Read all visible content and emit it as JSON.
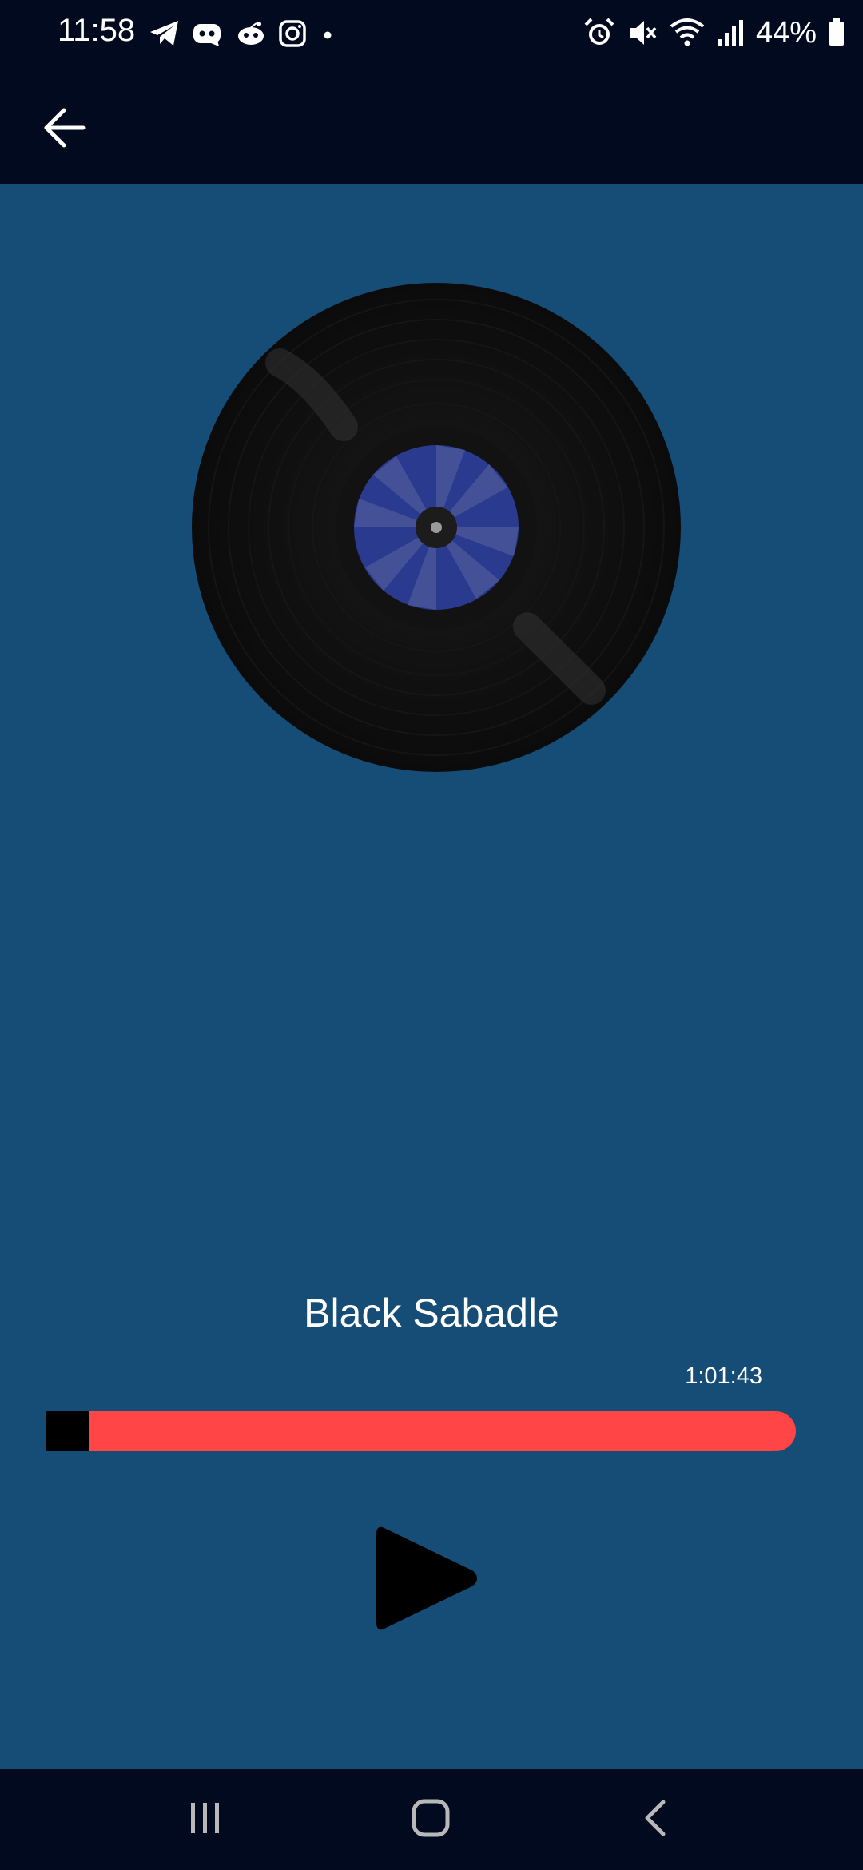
{
  "status_bar": {
    "time": "11:58",
    "left_icons": [
      "telegram-icon",
      "discord-icon",
      "reddit-icon",
      "instagram-icon",
      "notification-dot-icon"
    ],
    "right_icons": [
      "alarm-icon",
      "mute-icon",
      "wifi-icon",
      "signal-icon"
    ],
    "battery": "44%"
  },
  "app_bar": {
    "back_icon": "arrow-left-icon"
  },
  "player": {
    "artwork_icon": "vinyl-record-icon",
    "track_title": "Black Sabadle",
    "duration": "1:01:43",
    "progress_fraction": 0.056,
    "play_icon": "play-icon"
  },
  "colors": {
    "background": "#164d77",
    "bars": "#020a1f",
    "progress_track": "#ff4545",
    "progress_fill": "#000000",
    "label": "#2a3a8f"
  },
  "nav_bar": {
    "icons": [
      "recent-apps-icon",
      "home-icon",
      "back-icon"
    ]
  }
}
